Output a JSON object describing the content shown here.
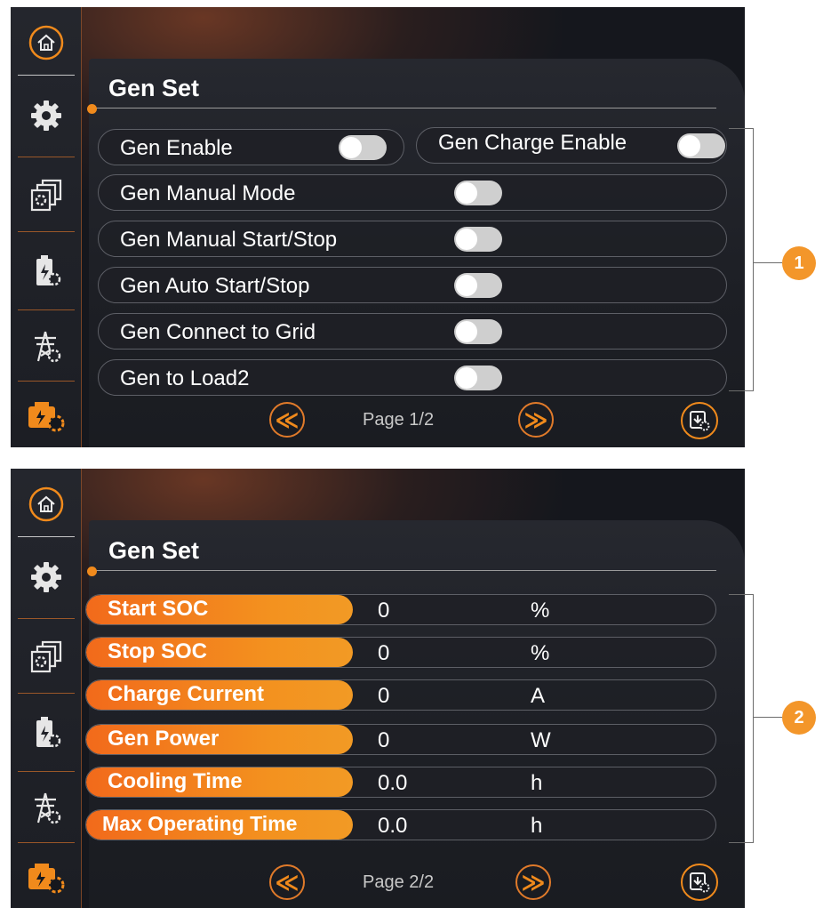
{
  "colors": {
    "accent": "#f08a1c",
    "background": "#15171d",
    "text": "#ffffff"
  },
  "sidebar_icons": [
    "home-icon",
    "gear-icon",
    "system-settings-icon",
    "battery-settings-icon",
    "grid-tower-settings-icon",
    "generator-settings-icon"
  ],
  "screen1": {
    "title": "Gen Set",
    "rows": [
      {
        "label": "Gen Enable",
        "state": "off"
      },
      {
        "label": "Gen Charge Enable",
        "state": "off"
      },
      {
        "label": "Gen Manual Mode",
        "state": "off"
      },
      {
        "label": "Gen Manual Start/Stop",
        "state": "off"
      },
      {
        "label": "Gen Auto Start/Stop",
        "state": "off"
      },
      {
        "label": "Gen Connect to Grid",
        "state": "off"
      },
      {
        "label": "Gen to Load2",
        "state": "off"
      }
    ],
    "prev_label": "≪",
    "next_label": "≫",
    "page": "Page 1/2",
    "callout": "1"
  },
  "screen2": {
    "title": "Gen Set",
    "rows": [
      {
        "label": "Start SOC",
        "value": "0",
        "unit": "%"
      },
      {
        "label": "Stop SOC",
        "value": "0",
        "unit": "%"
      },
      {
        "label": "Charge Current",
        "value": "0",
        "unit": "A"
      },
      {
        "label": "Gen Power",
        "value": "0",
        "unit": "W"
      },
      {
        "label": "Cooling Time",
        "value": "0.0",
        "unit": "h"
      },
      {
        "label": "Max Operating Time",
        "value": "0.0",
        "unit": "h"
      }
    ],
    "prev_label": "≪",
    "next_label": "≫",
    "page": "Page 2/2",
    "callout": "2"
  }
}
